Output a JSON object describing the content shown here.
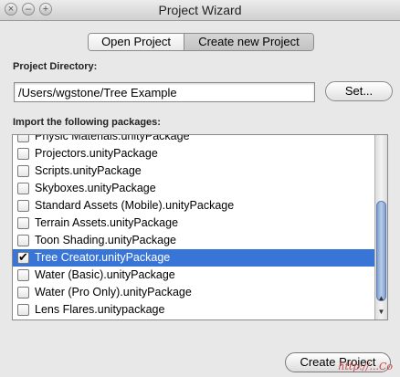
{
  "window": {
    "title": "Project Wizard"
  },
  "tabs": [
    {
      "label": "Open Project",
      "selected": false
    },
    {
      "label": "Create new Project",
      "selected": true
    }
  ],
  "project_directory": {
    "label": "Project Directory:",
    "value": "/Users/wgstone/Tree Example",
    "set_button": "Set..."
  },
  "packages": {
    "label": "Import the following packages:",
    "items": [
      {
        "label": "Physic Materials.unityPackage",
        "checked": false
      },
      {
        "label": "Projectors.unityPackage",
        "checked": false
      },
      {
        "label": "Scripts.unityPackage",
        "checked": false
      },
      {
        "label": "Skyboxes.unityPackage",
        "checked": false
      },
      {
        "label": "Standard Assets (Mobile).unityPackage",
        "checked": false
      },
      {
        "label": "Terrain Assets.unityPackage",
        "checked": false
      },
      {
        "label": "Toon Shading.unityPackage",
        "checked": false
      },
      {
        "label": "Tree Creator.unityPackage",
        "checked": true,
        "selected": true
      },
      {
        "label": "Water (Basic).unityPackage",
        "checked": false
      },
      {
        "label": "Water (Pro Only).unityPackage",
        "checked": false
      },
      {
        "label": "Lens Flares.unitypackage",
        "checked": false
      }
    ]
  },
  "create_button": "Create Project",
  "watermark": "http://...Co",
  "colors": {
    "selection": "#3875d7"
  }
}
